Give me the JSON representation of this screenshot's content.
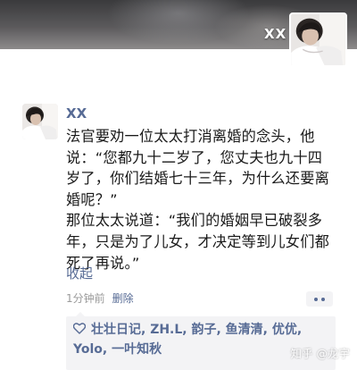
{
  "cover": {
    "name": "XX"
  },
  "post": {
    "author": "XX",
    "paragraphs": [
      "法官要劝一位太太打消离婚的念头，他说：“您都九十二岁了，您丈夫也九十四岁了，你们结婚七十三年，为什么还要离婚呢？”",
      "那位太太说道：“我们的婚姻早已破裂多年，只是为了儿女，才决定等到儿女们都死了再说。”"
    ],
    "collapse_label": "收起",
    "time": "1分钟前",
    "delete_label": "删除"
  },
  "likes": {
    "icon": "heart-icon",
    "names_text": "壮壮日记, ZH.L, 韵子, 鱼清清, 优优, Yolo, 一叶知秋"
  },
  "watermark": {
    "text": "知乎 @龙宇"
  },
  "colors": {
    "link_blue": "#576b95",
    "like_box_bg": "#f3f3f5",
    "meta_gray": "#9a9a9a"
  }
}
